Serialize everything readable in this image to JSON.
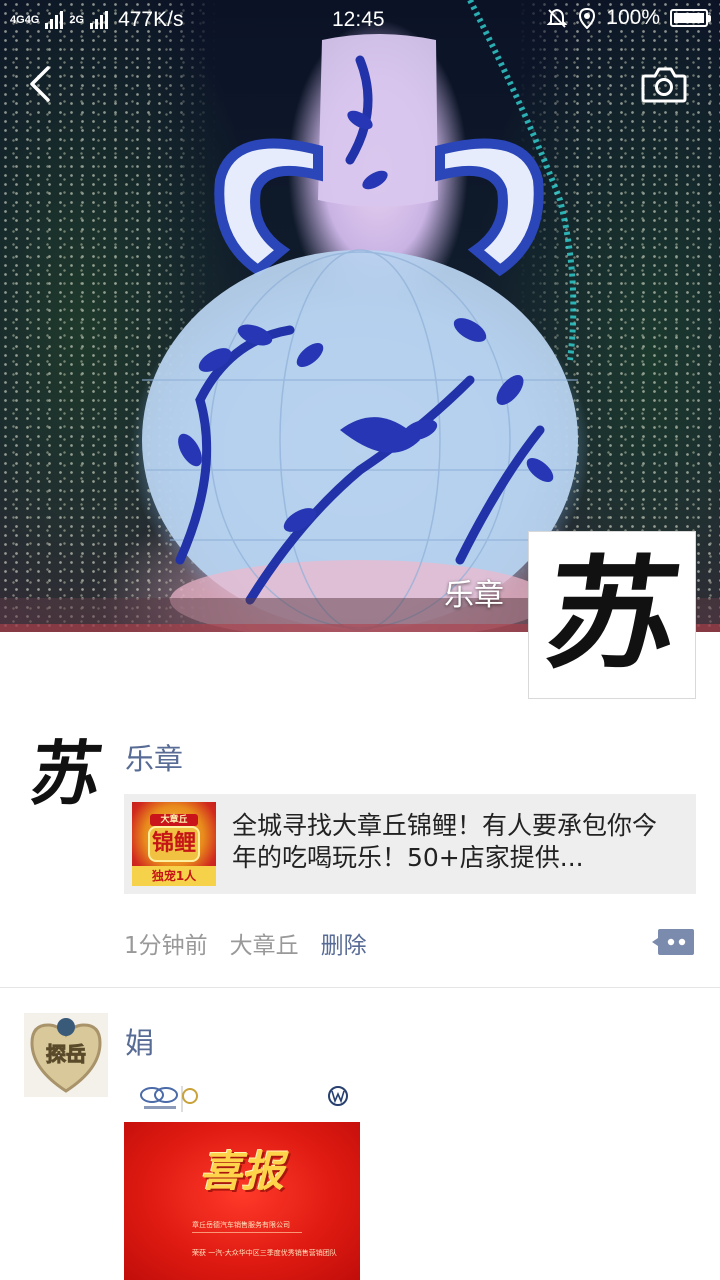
{
  "status_bar": {
    "network_1": "4G",
    "network_2": "4G",
    "network_3": "2G",
    "speed": "477K/s",
    "time": "12:45",
    "battery": "100%",
    "battery_level": 1.0,
    "icons": [
      "mute-bell-icon",
      "location-icon",
      "battery-icon"
    ]
  },
  "nav": {
    "back_icon": "chevron-left-icon",
    "camera_icon": "camera-icon"
  },
  "profile": {
    "cover_name": "乐章",
    "avatar_glyph": "苏"
  },
  "posts": [
    {
      "author": "乐章",
      "avatar_glyph": "苏",
      "share": {
        "thumb_top": "大章丘",
        "thumb_mid": "锦鲤",
        "thumb_bottom": "独宠1人",
        "title": "全城寻找大章丘锦鲤！有人要承包你今年的吃喝玩乐！50+店家提供..."
      },
      "time": "1分钟前",
      "location": "大章丘",
      "delete_label": "删除",
      "comment_icon": "comment-dots-icon"
    },
    {
      "author": "娟",
      "avatar_text": "探岳",
      "image": {
        "headline": "喜报",
        "line_1": "章丘岳德汽车销售服务有限公司",
        "line_2": "荣获 一汽-大众华中区三季度优秀销售营销团队"
      }
    }
  ],
  "colors": {
    "link": "#576b95",
    "meta": "#999999",
    "card_bg": "#eeeeee"
  }
}
